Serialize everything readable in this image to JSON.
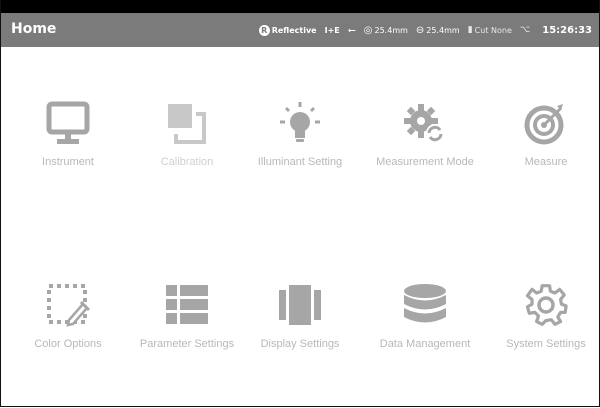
{
  "header": {
    "title": "Home",
    "mode_badge": "R",
    "mode": "Reflective",
    "ie": "I+E",
    "aperture1": "25.4mm",
    "aperture2": "25.4mm",
    "cut": "Cut None",
    "time": "15:26:33"
  },
  "menu": {
    "instrument": "Instrument",
    "calibration": "Calibration",
    "illuminant_setting": "Illuminant Setting",
    "measurement_mode": "Measurement Mode",
    "measure": "Measure",
    "color_options": "Color Options",
    "parameter_settings": "Parameter Settings",
    "display_settings": "Display Settings",
    "data_management": "Data Management",
    "system_settings": "System Settings"
  },
  "colors": {
    "icon": "#a6a6a6",
    "icon_disabled": "#c8c8c8",
    "titlebar": "#7b7b7b",
    "label": "#b8b8b8"
  }
}
